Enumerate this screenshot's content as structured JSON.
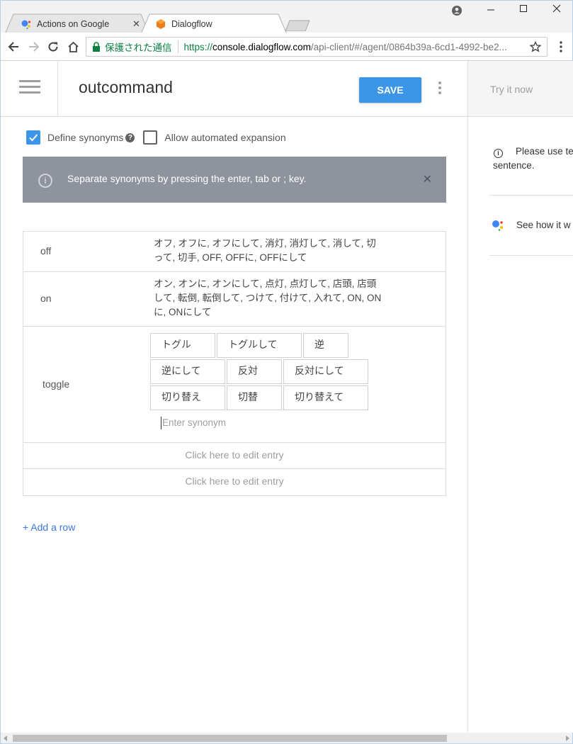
{
  "browser": {
    "tabs": [
      {
        "title": "Actions on Google",
        "active": false,
        "icon": "google-assistant-icon"
      },
      {
        "title": "Dialogflow",
        "active": true,
        "icon": "dialogflow-icon"
      }
    ],
    "security_label": "保護された通信",
    "url_protocol": "https://",
    "url_host": "console.dialogflow.com",
    "url_path": "/api-client/#/agent/0864b39a-6cd1-4992-be2..."
  },
  "header": {
    "title": "outcommand",
    "save_label": "SAVE"
  },
  "options": {
    "define_synonyms_label": "Define synonyms",
    "define_synonyms_checked": true,
    "allow_expansion_label": "Allow automated expansion",
    "allow_expansion_checked": false
  },
  "banner": {
    "prefix": "Separate synonyms by pressing the ",
    "key_enter": "enter",
    "comma": ", ",
    "key_tab": "tab",
    "or": " or ",
    "key_semicolon": ";",
    "suffix": " key."
  },
  "entries": [
    {
      "value": "off",
      "synonyms_line1": "オフ, オフに, オフにして, 消灯, 消灯して, 消して, 切",
      "synonyms_line2": "って, 切手, OFF, OFFに, OFFにして"
    },
    {
      "value": "on",
      "synonyms_line1": "オン, オンに, オンにして, 点灯, 点灯して, 店頭, 店頭",
      "synonyms_line2": "して, 転倒, 転倒して, つけて, 付けて, 入れて, ON, ON",
      "synonyms_line3": "に, ONにして"
    },
    {
      "value": "toggle",
      "chips": [
        "トグル",
        "トグルして",
        "逆",
        "逆にして",
        "反対",
        "反対にして",
        "切り替え",
        "切替",
        "切り替えて"
      ],
      "input_placeholder": "Enter synonym"
    }
  ],
  "empty_entry_label": "Click here to edit entry",
  "add_row_label": "+ Add a row",
  "try_panel": {
    "try_label": "Try it now",
    "hint_line1": "Please use te",
    "hint_line2": "sentence.",
    "see_how": "See how it w"
  },
  "colors": {
    "accent": "#3b96e8",
    "banner_bg": "#8f939e",
    "link": "#3b78e7",
    "secure_green": "#0b8043"
  }
}
